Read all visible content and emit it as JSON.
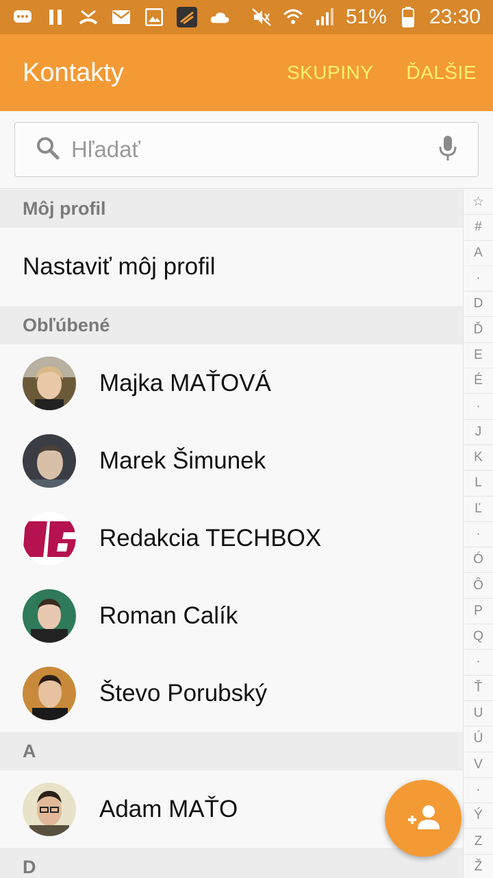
{
  "status_bar": {
    "battery_percent": "51%",
    "time": "23:30",
    "icons_left": [
      "chat-icon",
      "pause-icon",
      "missed-call-icon",
      "mail-icon",
      "gallery-icon",
      "app-icon",
      "cloud-icon"
    ],
    "icons_right": [
      "mute-icon",
      "wifi-icon",
      "signal-icon",
      "battery-icon"
    ],
    "color": "#d8872a"
  },
  "app_bar": {
    "title": "Kontakty",
    "groups_label": "SKUPINY",
    "more_label": "ĎALŠIE",
    "color": "#f39a35",
    "action_color": "#fff36b"
  },
  "search": {
    "placeholder": "Hľadať"
  },
  "my_profile": {
    "header": "Môj profil",
    "setup_label": "Nastaviť môj profil"
  },
  "favorites": {
    "header": "Obľúbené",
    "contacts": [
      {
        "name": "Majka MAŤOVÁ"
      },
      {
        "name": "Marek Šimunek"
      },
      {
        "name": "Redakcia TECHBOX"
      },
      {
        "name": "Roman Calík"
      },
      {
        "name": "Števo Porubský"
      }
    ]
  },
  "section_a": {
    "header": "A",
    "contacts": [
      {
        "name": "Adam MAŤO"
      }
    ]
  },
  "section_d": {
    "header": "D"
  },
  "index_letters": [
    "☆",
    "#",
    "A",
    "·",
    "D",
    "Ď",
    "E",
    "É",
    "·",
    "J",
    "K",
    "L",
    "Ľ",
    "·",
    "Ó",
    "Ô",
    "P",
    "Q",
    "·",
    "Ť",
    "U",
    "Ú",
    "V",
    "·",
    "Ý",
    "Z",
    "Ž"
  ]
}
